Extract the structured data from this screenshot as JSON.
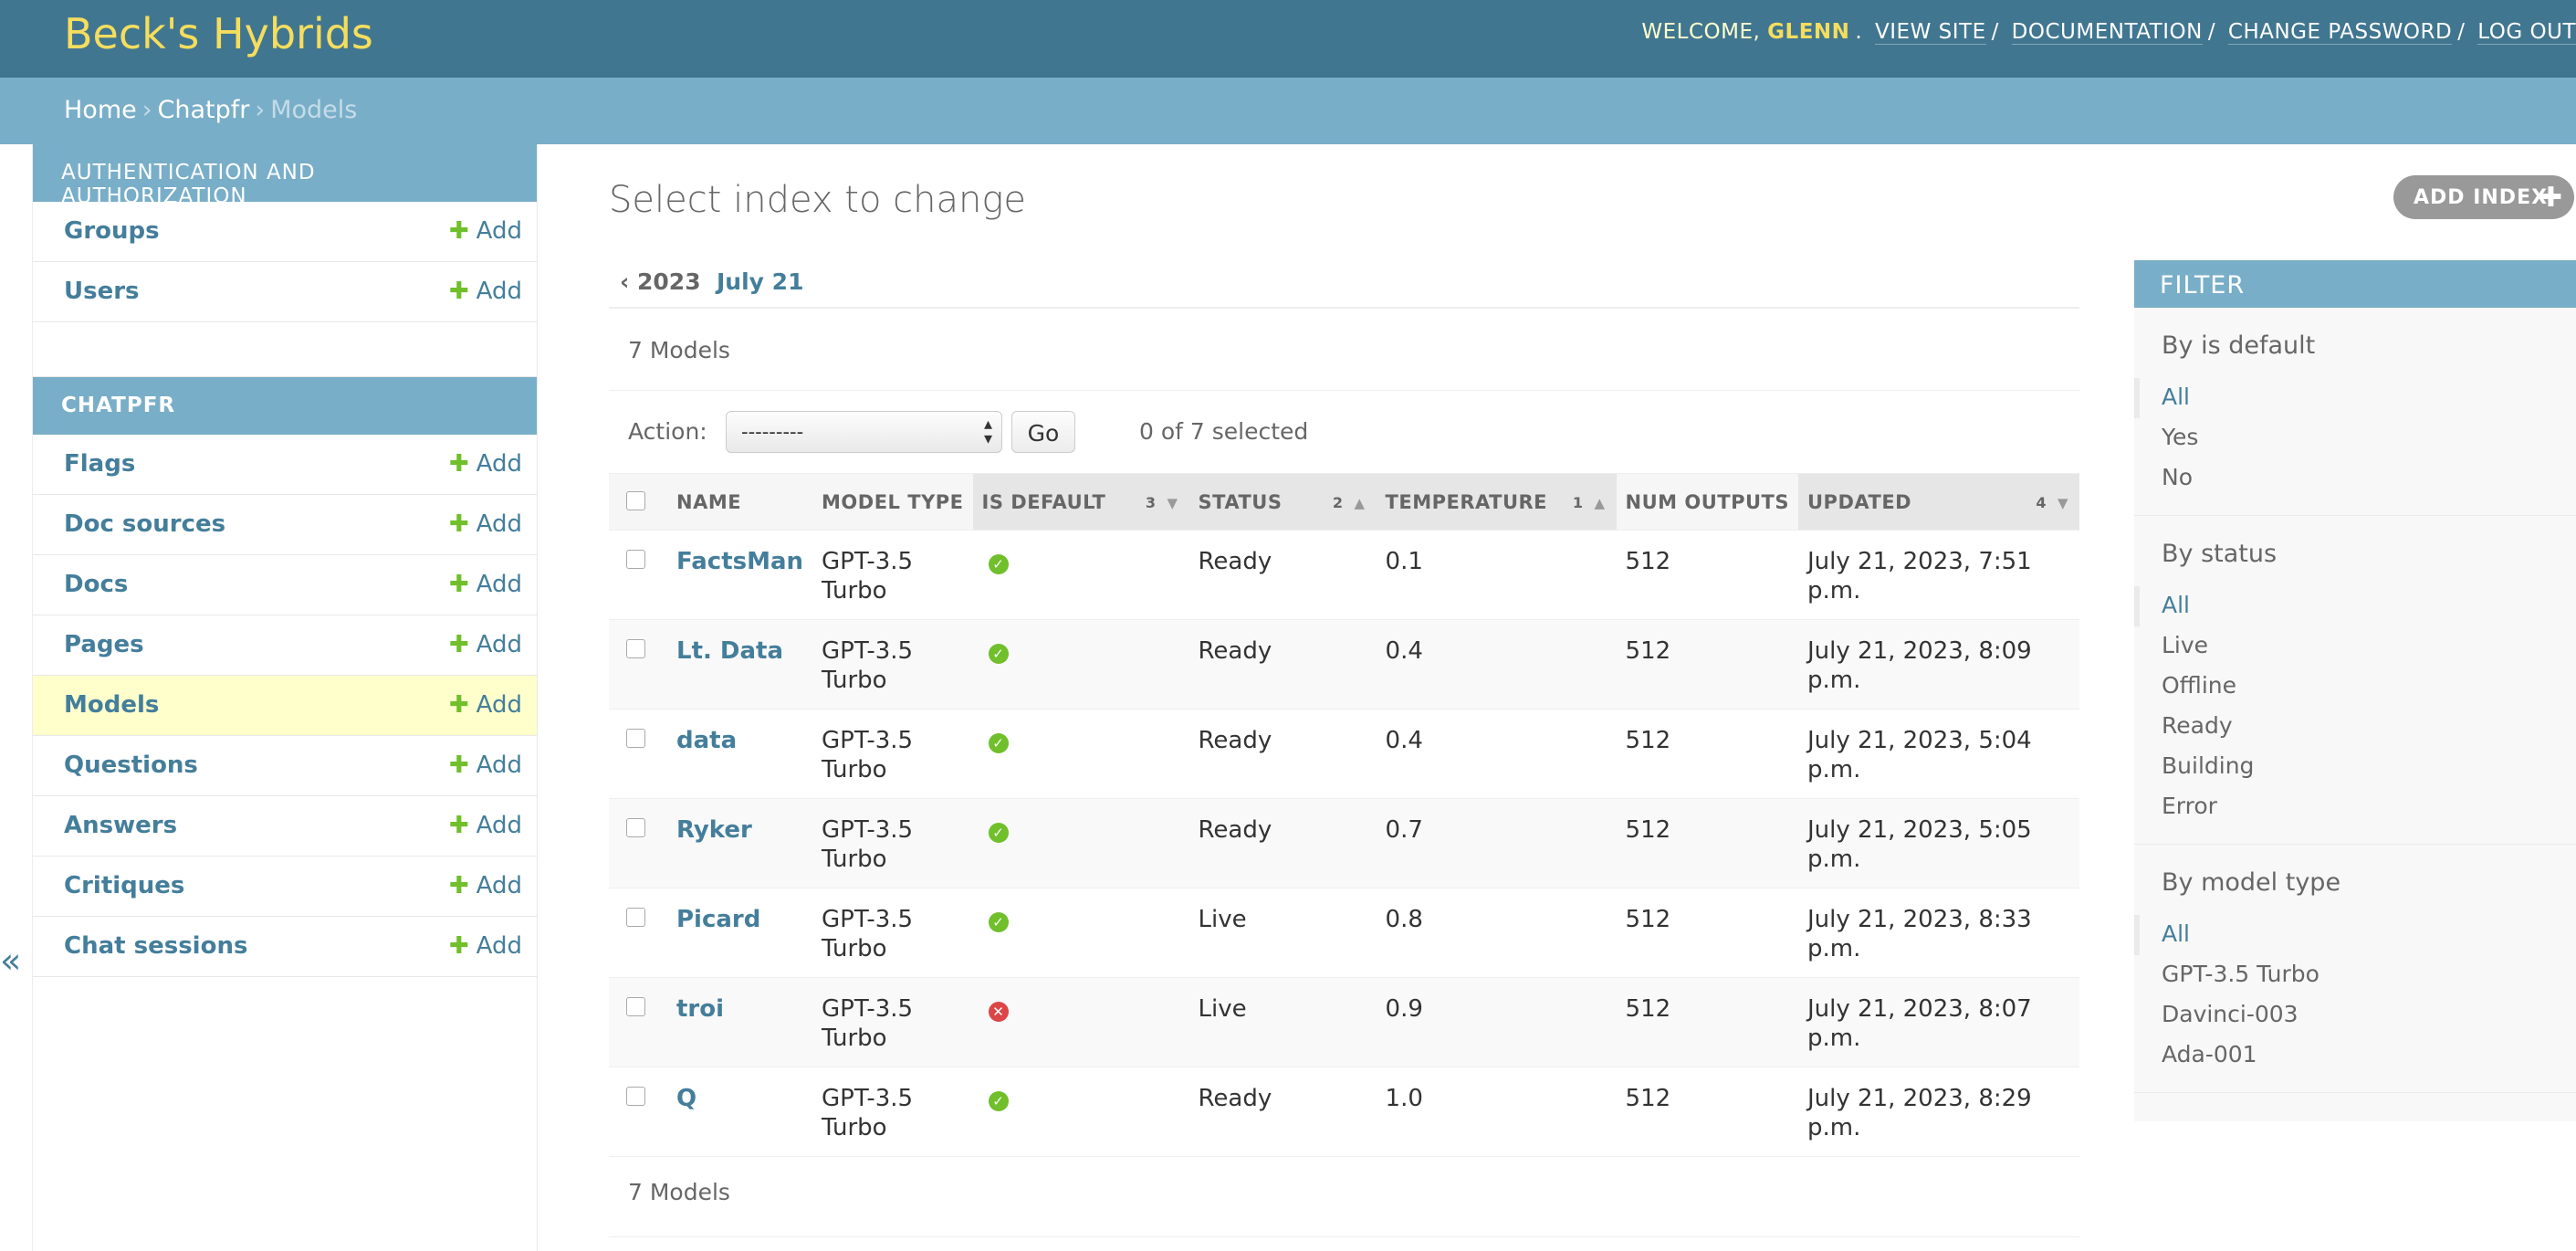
{
  "header": {
    "brand": "Beck's Hybrids",
    "welcome": "WELCOME,",
    "username": "GLENN",
    "links": [
      "VIEW SITE",
      "DOCUMENTATION",
      "CHANGE PASSWORD",
      "LOG OUT"
    ]
  },
  "breadcrumbs": [
    "Home",
    "Chatpfr",
    "Models"
  ],
  "sidebar": {
    "modules": [
      {
        "caption": "AUTHENTICATION AND AUTHORIZATION",
        "items": [
          {
            "label": "Groups",
            "add": "Add"
          },
          {
            "label": "Users",
            "add": "Add"
          }
        ]
      },
      {
        "caption": "CHATPFR",
        "items": [
          {
            "label": "Flags",
            "add": "Add"
          },
          {
            "label": "Doc sources",
            "add": "Add"
          },
          {
            "label": "Docs",
            "add": "Add"
          },
          {
            "label": "Pages",
            "add": "Add"
          },
          {
            "label": "Models",
            "add": "Add"
          },
          {
            "label": "Questions",
            "add": "Add"
          },
          {
            "label": "Answers",
            "add": "Add"
          },
          {
            "label": "Critiques",
            "add": "Add"
          },
          {
            "label": "Chat sessions",
            "add": "Add"
          }
        ]
      }
    ],
    "collapse": "«"
  },
  "content": {
    "title": "Select index to change",
    "add_button": "ADD INDEX",
    "date_hierarchy": {
      "back": "‹ 2023",
      "current": "July 21"
    },
    "count": "7 Models",
    "action_label": "Action:",
    "action_value": "---------",
    "go": "Go",
    "selected": "0 of 7 selected",
    "columns": [
      {
        "label": "NAME",
        "sort": ""
      },
      {
        "label": "MODEL TYPE",
        "sort": ""
      },
      {
        "label": "IS DEFAULT",
        "sort": "3"
      },
      {
        "label": "STATUS",
        "sort": "2"
      },
      {
        "label": "TEMPERATURE",
        "sort": "1"
      },
      {
        "label": "NUM OUTPUTS",
        "sort": ""
      },
      {
        "label": "UPDATED",
        "sort": "4"
      }
    ],
    "rows": [
      {
        "name": "FactsMan",
        "type1": "GPT-3.5",
        "type2": "Turbo",
        "default": true,
        "status": "Ready",
        "temp": "0.1",
        "outputs": "512",
        "updated": "July 21, 2023, 7:51 p.m."
      },
      {
        "name": "Lt. Data",
        "type1": "GPT-3.5",
        "type2": "Turbo",
        "default": true,
        "status": "Ready",
        "temp": "0.4",
        "outputs": "512",
        "updated": "July 21, 2023, 8:09 p.m."
      },
      {
        "name": "data",
        "type1": "GPT-3.5",
        "type2": "Turbo",
        "default": true,
        "status": "Ready",
        "temp": "0.4",
        "outputs": "512",
        "updated": "July 21, 2023, 5:04 p.m."
      },
      {
        "name": "Ryker",
        "type1": "GPT-3.5",
        "type2": "Turbo",
        "default": true,
        "status": "Ready",
        "temp": "0.7",
        "outputs": "512",
        "updated": "July 21, 2023, 5:05 p.m."
      },
      {
        "name": "Picard",
        "type1": "GPT-3.5",
        "type2": "Turbo",
        "default": true,
        "status": "Live",
        "temp": "0.8",
        "outputs": "512",
        "updated": "July 21, 2023, 8:33 p.m."
      },
      {
        "name": "troi",
        "type1": "GPT-3.5",
        "type2": "Turbo",
        "default": false,
        "status": "Live",
        "temp": "0.9",
        "outputs": "512",
        "updated": "July 21, 2023, 8:07 p.m."
      },
      {
        "name": "Q",
        "type1": "GPT-3.5",
        "type2": "Turbo",
        "default": true,
        "status": "Ready",
        "temp": "1.0",
        "outputs": "512",
        "updated": "July 21, 2023, 8:29 p.m."
      }
    ]
  },
  "filter": {
    "title": "FILTER",
    "groups": [
      {
        "title": "By is default",
        "options": [
          "All",
          "Yes",
          "No"
        ]
      },
      {
        "title": "By status",
        "options": [
          "All",
          "Live",
          "Offline",
          "Ready",
          "Building",
          "Error"
        ]
      },
      {
        "title": "By model type",
        "options": [
          "All",
          "GPT-3.5 Turbo",
          "Davinci-003",
          "Ada-001"
        ]
      }
    ]
  },
  "colors": {
    "header": "#417690",
    "brand": "#f5dd5d",
    "module": "#79aec8",
    "link": "#447e9b",
    "add": "#70bf2b",
    "current_row": "#ffffcc"
  }
}
